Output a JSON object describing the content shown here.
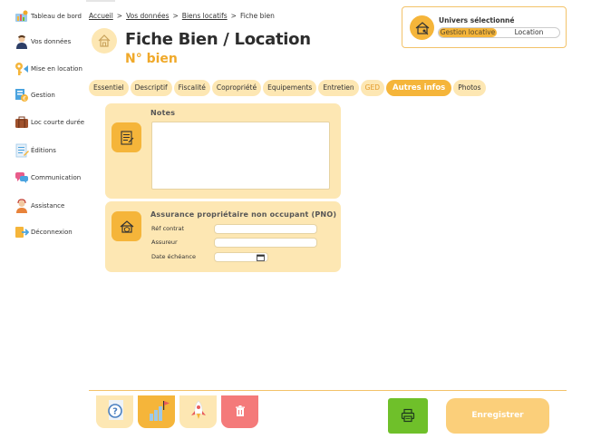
{
  "sidebar": {
    "items": [
      {
        "label": "Tableau de bord",
        "icon": "dashboard-icon"
      },
      {
        "label": "Vos données",
        "icon": "user-icon"
      },
      {
        "label": "Mise en location",
        "icon": "key-icon"
      },
      {
        "label": "Gestion",
        "icon": "gestion-icon"
      },
      {
        "label": "Loc courte durée",
        "icon": "suitcase-icon"
      },
      {
        "label": "Éditions",
        "icon": "document-icon"
      },
      {
        "label": "Communication",
        "icon": "chat-icon"
      },
      {
        "label": "Assistance",
        "icon": "support-agent-icon"
      },
      {
        "label": "Déconnexion",
        "icon": "logout-icon"
      }
    ]
  },
  "breadcrumb": {
    "items": [
      "Accueil",
      "Vos données",
      "Biens locatifs"
    ],
    "current": "Fiche bien",
    "separator": ">"
  },
  "header": {
    "title": "Fiche Bien / Location",
    "subtitle": "N° bien"
  },
  "universe": {
    "title": "Univers sélectionné",
    "options": [
      "Gestion locative",
      "Location"
    ],
    "selected": "Gestion locative"
  },
  "tabs": [
    {
      "label": "Essentiel"
    },
    {
      "label": "Descriptif"
    },
    {
      "label": "Fiscalité"
    },
    {
      "label": "Copropriété"
    },
    {
      "label": "Equipements"
    },
    {
      "label": "Entretien"
    },
    {
      "label": "GED"
    },
    {
      "label": "Autres infos",
      "active": true
    },
    {
      "label": "Photos"
    }
  ],
  "notes": {
    "title": "Notes",
    "value": ""
  },
  "pno": {
    "title": "Assurance propriétaire non occupant (PNO)",
    "fields": {
      "ref_label": "Réf contrat",
      "ref_value": "",
      "assureur_label": "Assureur",
      "assureur_value": "",
      "date_label": "Date échéance",
      "date_value": ""
    }
  },
  "footer": {
    "save_label": "Enregistrer"
  },
  "colors": {
    "accent": "#f5b53a",
    "card_bg": "#fde7b3",
    "print_green": "#6fc02a",
    "delete_red": "#f47a7a",
    "save_bg": "#fbcf7a"
  }
}
